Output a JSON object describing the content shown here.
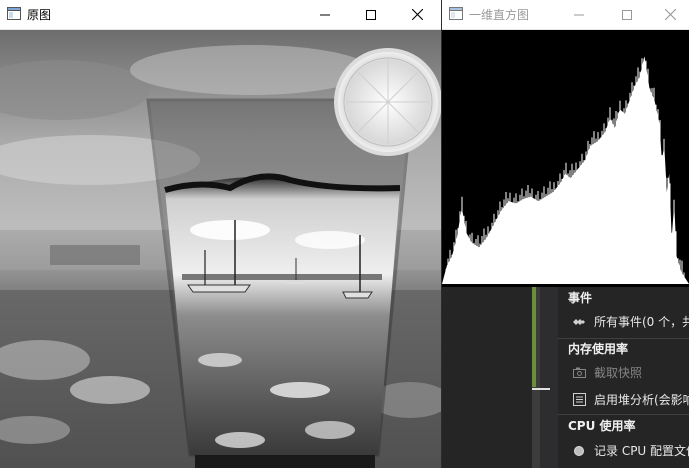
{
  "left_window": {
    "title": "原图"
  },
  "right_window": {
    "title": "一维直方图"
  },
  "diagnostics": {
    "events_header": "事件",
    "all_events": "所有事件(0 个，共",
    "memory_header": "内存使用率",
    "snapshot": "截取快照",
    "heap_analysis": "启用堆分析(会影响",
    "cpu_header": "CPU 使用率",
    "record_cpu": "记录 CPU 配置文件"
  },
  "colors": {
    "titlebar_bg": "#ffffff",
    "histogram_bg": "#000000",
    "histogram_fill": "#ffffff",
    "panel_bg": "#252526",
    "panel_accent": "#6a8f3c"
  }
}
